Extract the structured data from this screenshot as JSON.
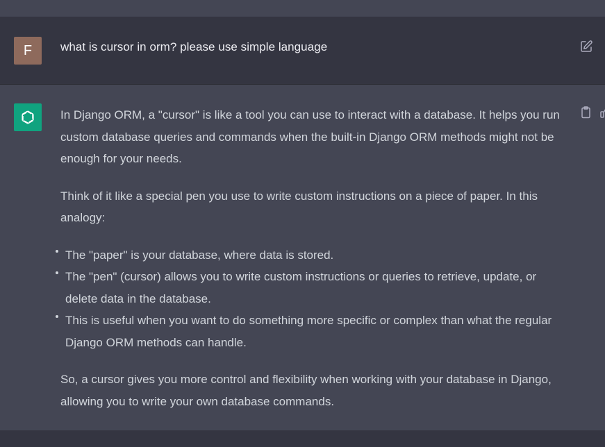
{
  "user_message": {
    "avatar_initial": "F",
    "text": "what is cursor in orm? please use simple language"
  },
  "assistant_message": {
    "paragraph_1": "In Django ORM, a \"cursor\" is like a tool you can use to interact with a database. It helps you run custom database queries and commands when the built-in Django ORM methods might not be enough for your needs.",
    "paragraph_2": "Think of it like a special pen you use to write custom instructions on a piece of paper. In this analogy:",
    "bullets": [
      "The \"paper\" is your database, where data is stored.",
      "The \"pen\" (cursor) allows you to write custom instructions or queries to retrieve, update, or delete data in the database.",
      "This is useful when you want to do something more specific or complex than what the regular Django ORM methods can handle."
    ],
    "paragraph_3": "So, a cursor gives you more control and flexibility when working with your database in Django, allowing you to write your own database commands."
  },
  "colors": {
    "user_bg": "#343541",
    "assistant_bg": "#444654",
    "assistant_avatar": "#10a37f",
    "user_avatar": "#8e6a5c",
    "text": "#d1d5db"
  },
  "icons": {
    "edit": "edit-icon",
    "copy": "clipboard-icon",
    "gpt": "openai-logo-icon"
  }
}
